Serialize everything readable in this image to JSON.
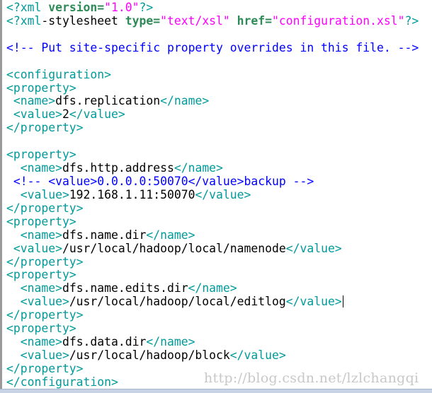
{
  "editor": {
    "lines": [
      [
        {
          "t": "<?xml ",
          "c": "tag"
        },
        {
          "t": "version=",
          "c": "attr"
        },
        {
          "t": "\"1.0\"",
          "c": "str"
        },
        {
          "t": "?>",
          "c": "tag"
        }
      ],
      [
        {
          "t": "<?xml",
          "c": "tag"
        },
        {
          "t": "-stylesheet ",
          "c": "txt"
        },
        {
          "t": "type=",
          "c": "attr"
        },
        {
          "t": "\"text/xsl\" ",
          "c": "str"
        },
        {
          "t": "href=",
          "c": "attr"
        },
        {
          "t": "\"configuration.xsl\"",
          "c": "str"
        },
        {
          "t": "?>",
          "c": "tag"
        }
      ],
      [],
      [
        {
          "t": "<!-- Put site-specific property overrides in this file. -->",
          "c": "cmt"
        }
      ],
      [],
      [
        {
          "t": "<configuration>",
          "c": "tag"
        }
      ],
      [
        {
          "t": "<property>",
          "c": "tag"
        }
      ],
      [
        {
          "t": " <name>",
          "c": "tag"
        },
        {
          "t": "dfs.replication",
          "c": "txt"
        },
        {
          "t": "</name>",
          "c": "tag"
        }
      ],
      [
        {
          "t": " <value>",
          "c": "tag"
        },
        {
          "t": "2",
          "c": "txt"
        },
        {
          "t": "</value>",
          "c": "tag"
        }
      ],
      [
        {
          "t": "</property>",
          "c": "tag"
        }
      ],
      [],
      [
        {
          "t": "<property>",
          "c": "tag"
        }
      ],
      [
        {
          "t": "  <name>",
          "c": "tag"
        },
        {
          "t": "dfs.http.address",
          "c": "txt"
        },
        {
          "t": "</name>",
          "c": "tag"
        }
      ],
      [
        {
          "t": " <!-- <value>0.0.0.0:50070</value>backup -->",
          "c": "cmt"
        }
      ],
      [
        {
          "t": "  <value>",
          "c": "tag"
        },
        {
          "t": "192.168.1.11:50070",
          "c": "txt"
        },
        {
          "t": "</value>",
          "c": "tag"
        }
      ],
      [
        {
          "t": "</property>",
          "c": "tag"
        }
      ],
      [
        {
          "t": "<property>",
          "c": "tag"
        }
      ],
      [
        {
          "t": "  <name>",
          "c": "tag"
        },
        {
          "t": "dfs.name.dir",
          "c": "txt"
        },
        {
          "t": "</name>",
          "c": "tag"
        }
      ],
      [
        {
          "t": " <value>",
          "c": "tag"
        },
        {
          "t": "/usr/local/hadoop/local/namenode",
          "c": "txt"
        },
        {
          "t": "</value>",
          "c": "tag"
        }
      ],
      [
        {
          "t": "</property>",
          "c": "tag"
        }
      ],
      [
        {
          "t": "<property>",
          "c": "tag"
        }
      ],
      [
        {
          "t": "  <name>",
          "c": "tag"
        },
        {
          "t": "dfs.name.edits.dir",
          "c": "txt"
        },
        {
          "t": "</name>",
          "c": "tag"
        }
      ],
      [
        {
          "t": "  <value>",
          "c": "tag"
        },
        {
          "t": "/usr/local/hadoop/local/editlog",
          "c": "txt"
        },
        {
          "t": "</value>",
          "c": "tag"
        }
      ],
      [
        {
          "t": "</property>",
          "c": "tag"
        }
      ],
      [
        {
          "t": "<property>",
          "c": "tag"
        }
      ],
      [
        {
          "t": "  <name>",
          "c": "tag"
        },
        {
          "t": "dfs.data.dir",
          "c": "txt"
        },
        {
          "t": "</name>",
          "c": "tag"
        }
      ],
      [
        {
          "t": "  <value>",
          "c": "tag"
        },
        {
          "t": "/usr/local/hadoop/block",
          "c": "txt"
        },
        {
          "t": "</value>",
          "c": "tag"
        }
      ],
      [
        {
          "t": "</property>",
          "c": "tag"
        }
      ],
      [
        {
          "t": "</configuration>",
          "c": "tag"
        }
      ]
    ],
    "cursor_line": 22
  },
  "watermark": "http://blog.csdn.net/lzlchangqi",
  "colors": {
    "tag": "#009a9a",
    "attribute": "#2e8b57",
    "string": "#ff00ff",
    "comment": "#0000ff",
    "text": "#000000"
  }
}
